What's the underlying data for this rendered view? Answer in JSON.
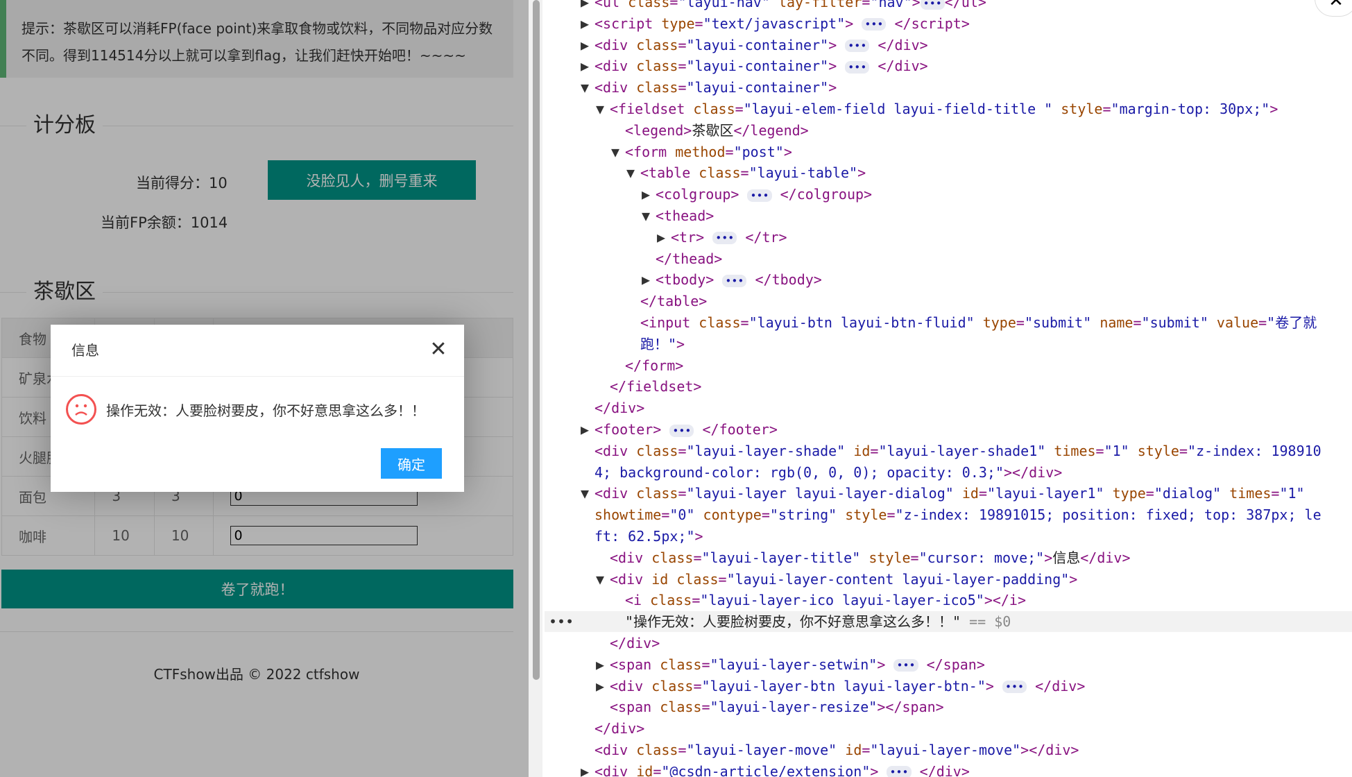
{
  "page": {
    "tip": "提示：茶歇区可以消耗FP(face point)来拿取食物或饮料，不同物品对应分数不同。得到114514分以上就可以拿到flag，让我们赶快开始吧！~~~~",
    "scoreboard_title": "计分板",
    "score_label": "当前得分：10",
    "reset_button": "没脸见人，删号重来",
    "fp_label": "当前FP余额：1014",
    "tea_title": "茶歇区",
    "table": {
      "header": [
        "食物",
        "",
        "",
        ""
      ],
      "rows": [
        {
          "name": "矿泉水",
          "a": "",
          "b": "",
          "qty": ""
        },
        {
          "name": "饮料",
          "a": "",
          "b": "",
          "qty": ""
        },
        {
          "name": "火腿肠",
          "a": "",
          "b": "",
          "qty": ""
        },
        {
          "name": "面包",
          "a": "3",
          "b": "3",
          "qty": "0"
        },
        {
          "name": "咖啡",
          "a": "10",
          "b": "10",
          "qty": "0"
        }
      ]
    },
    "submit_button": "卷了就跑！",
    "footer": "CTFshow出品 © 2022 ctfshow"
  },
  "dialog": {
    "title": "信息",
    "close": "✕",
    "message": "操作无效：人要脸树要皮，你不好意思拿这么多！！",
    "icon": "sad-face-icon",
    "ok_button": "确定"
  },
  "devtools": {
    "lines": [
      {
        "indent": 0,
        "arrow": "▶",
        "html": "<span class='tag'>&lt;ul</span> <span class='attr'>class</span>=<span class='val'>\"layui-nav\"</span> <span class='attr'>lay-filter</span>=<span class='val'>\"nav\"</span><span class='tag'>&gt;</span><span class='dots'>•••</span><span class='tag'>&lt;/ul&gt;</span>"
      },
      {
        "indent": 0,
        "arrow": "▶",
        "html": "<span class='tag'>&lt;script</span> <span class='attr'>type</span>=<span class='val'>\"text/javascript\"</span><span class='tag'>&gt;</span> <span class='dots'>•••</span> <span class='tag'>&lt;/script&gt;</span>"
      },
      {
        "indent": 0,
        "arrow": "▶",
        "html": "<span class='tag'>&lt;div</span> <span class='attr'>class</span>=<span class='val'>\"layui-container\"</span><span class='tag'>&gt;</span> <span class='dots'>•••</span> <span class='tag'>&lt;/div&gt;</span>"
      },
      {
        "indent": 0,
        "arrow": "▶",
        "html": "<span class='tag'>&lt;div</span> <span class='attr'>class</span>=<span class='val'>\"layui-container\"</span><span class='tag'>&gt;</span> <span class='dots'>•••</span> <span class='tag'>&lt;/div&gt;</span>"
      },
      {
        "indent": 0,
        "arrow": "▼",
        "html": "<span class='tag'>&lt;div</span> <span class='attr'>class</span>=<span class='val'>\"layui-container\"</span><span class='tag'>&gt;</span>"
      },
      {
        "indent": 1,
        "arrow": "▼",
        "html": "<span class='tag'>&lt;fieldset</span> <span class='attr'>class</span>=<span class='val'>\"layui-elem-field layui-field-title \"</span> <span class='attr'>style</span>=<span class='val'>\"margin-top: 30px;\"</span><span class='tag'>&gt;</span>"
      },
      {
        "indent": 2,
        "arrow": "",
        "html": "<span class='tag'>&lt;legend&gt;</span><span class='txt'>茶歇区</span><span class='tag'>&lt;/legend&gt;</span>"
      },
      {
        "indent": 2,
        "arrow": "▼",
        "html": "<span class='tag'>&lt;form</span> <span class='attr'>method</span>=<span class='val'>\"post\"</span><span class='tag'>&gt;</span>"
      },
      {
        "indent": 3,
        "arrow": "▼",
        "html": "<span class='tag'>&lt;table</span> <span class='attr'>class</span>=<span class='val'>\"layui-table\"</span><span class='tag'>&gt;</span>"
      },
      {
        "indent": 4,
        "arrow": "▶",
        "html": "<span class='tag'>&lt;colgroup&gt;</span> <span class='dots'>•••</span> <span class='tag'>&lt;/colgroup&gt;</span>"
      },
      {
        "indent": 4,
        "arrow": "▼",
        "html": "<span class='tag'>&lt;thead&gt;</span>"
      },
      {
        "indent": 5,
        "arrow": "▶",
        "html": "<span class='tag'>&lt;tr&gt;</span> <span class='dots'>•••</span> <span class='tag'>&lt;/tr&gt;</span>"
      },
      {
        "indent": 4,
        "arrow": "",
        "html": "<span class='tag'>&lt;/thead&gt;</span>"
      },
      {
        "indent": 4,
        "arrow": "▶",
        "html": "<span class='tag'>&lt;tbody&gt;</span> <span class='dots'>•••</span> <span class='tag'>&lt;/tbody&gt;</span>"
      },
      {
        "indent": 3,
        "arrow": "",
        "html": "<span class='tag'>&lt;/table&gt;</span>"
      },
      {
        "indent": 3,
        "arrow": "",
        "html": "<span class='tag'>&lt;input</span> <span class='attr'>class</span>=<span class='val'>\"layui-btn layui-btn-fluid\"</span> <span class='attr'>type</span>=<span class='val'>\"submit\"</span> <span class='attr'>name</span>=<span class='val'>\"submit\"</span> <span class='attr'>value</span>=<span class='val'>\"卷了就</span>"
      },
      {
        "indent": 3,
        "arrow": "",
        "html": "<span class='val'>跑！\"</span><span class='tag'>&gt;</span>"
      },
      {
        "indent": 2,
        "arrow": "",
        "html": "<span class='tag'>&lt;/form&gt;</span>"
      },
      {
        "indent": 1,
        "arrow": "",
        "html": "<span class='tag'>&lt;/fieldset&gt;</span>"
      },
      {
        "indent": 0,
        "arrow": "",
        "html": "<span class='tag'>&lt;/div&gt;</span>"
      },
      {
        "indent": 0,
        "arrow": "▶",
        "html": "<span class='tag'>&lt;footer&gt;</span> <span class='dots'>•••</span> <span class='tag'>&lt;/footer&gt;</span>"
      },
      {
        "indent": 0,
        "arrow": "",
        "html": "<span class='tag'>&lt;div</span> <span class='attr'>class</span>=<span class='val'>\"layui-layer-shade\"</span> <span class='attr'>id</span>=<span class='val'>\"layui-layer-shade1\"</span> <span class='attr'>times</span>=<span class='val'>\"1\"</span> <span class='attr'>style</span>=<span class='val'>\"z-index: 198910</span>"
      },
      {
        "indent": 0,
        "arrow": "",
        "html": "<span class='val'>4; background-color: rgb(0, 0, 0); opacity: 0.3;\"</span><span class='tag'>&gt;&lt;/div&gt;</span>"
      },
      {
        "indent": 0,
        "arrow": "▼",
        "html": "<span class='tag'>&lt;div</span> <span class='attr'>class</span>=<span class='val'>\"layui-layer layui-layer-dialog\"</span> <span class='attr'>id</span>=<span class='val'>\"layui-layer1\"</span> <span class='attr'>type</span>=<span class='val'>\"dialog\"</span> <span class='attr'>times</span>=<span class='val'>\"1\"</span>"
      },
      {
        "indent": 0,
        "arrow": "",
        "html": "<span class='attr'>showtime</span>=<span class='val'>\"0\"</span> <span class='attr'>contype</span>=<span class='val'>\"string\"</span> <span class='attr'>style</span>=<span class='val'>\"z-index: 19891015; position: fixed; top: 387px; le</span>"
      },
      {
        "indent": 0,
        "arrow": "",
        "html": "<span class='val'>ft: 62.5px;\"</span><span class='tag'>&gt;</span>"
      },
      {
        "indent": 1,
        "arrow": "",
        "html": "<span class='tag'>&lt;div</span> <span class='attr'>class</span>=<span class='val'>\"layui-layer-title\"</span> <span class='attr'>style</span>=<span class='val'>\"cursor: move;\"</span><span class='tag'>&gt;</span><span class='txt'>信息</span><span class='tag'>&lt;/div&gt;</span>"
      },
      {
        "indent": 1,
        "arrow": "▼",
        "html": "<span class='tag'>&lt;div</span> <span class='attr'>id class</span>=<span class='val'>\"layui-layer-content layui-layer-padding\"</span><span class='tag'>&gt;</span>"
      },
      {
        "indent": 2,
        "arrow": "",
        "html": "<span class='tag'>&lt;i</span> <span class='attr'>class</span>=<span class='val'>\"layui-layer-ico layui-layer-ico5\"</span><span class='tag'>&gt;&lt;/i&gt;</span>"
      },
      {
        "indent": 2,
        "arrow": "",
        "sel": true,
        "html": "<span class='txt'>\"操作无效：人要脸树要皮，你不好意思拿这么多！！\"</span> <span class='dim'>== $0</span>"
      },
      {
        "indent": 1,
        "arrow": "",
        "html": "<span class='tag'>&lt;/div&gt;</span>"
      },
      {
        "indent": 1,
        "arrow": "▶",
        "html": "<span class='tag'>&lt;span</span> <span class='attr'>class</span>=<span class='val'>\"layui-layer-setwin\"</span><span class='tag'>&gt;</span> <span class='dots'>•••</span> <span class='tag'>&lt;/span&gt;</span>"
      },
      {
        "indent": 1,
        "arrow": "▶",
        "html": "<span class='tag'>&lt;div</span> <span class='attr'>class</span>=<span class='val'>\"layui-layer-btn layui-layer-btn-\"</span><span class='tag'>&gt;</span> <span class='dots'>•••</span> <span class='tag'>&lt;/div&gt;</span>"
      },
      {
        "indent": 1,
        "arrow": "",
        "html": "<span class='tag'>&lt;span</span> <span class='attr'>class</span>=<span class='val'>\"layui-layer-resize\"</span><span class='tag'>&gt;&lt;/span&gt;</span>"
      },
      {
        "indent": 0,
        "arrow": "",
        "html": "<span class='tag'>&lt;/div&gt;</span>"
      },
      {
        "indent": 0,
        "arrow": "",
        "html": "<span class='tag'>&lt;div</span> <span class='attr'>class</span>=<span class='val'>\"layui-layer-move\"</span> <span class='attr'>id</span>=<span class='val'>\"layui-layer-move\"</span><span class='tag'>&gt;&lt;/div&gt;</span>"
      },
      {
        "indent": 0,
        "arrow": "▶",
        "html": "<span class='tag'>&lt;div</span> <span class='attr'>id</span>=<span class='val'>\"@csdn-article/extension\"</span><span class='tag'>&gt;</span> <span class='dots'>•••</span> <span class='tag'>&lt;/div&gt;</span>"
      }
    ]
  }
}
